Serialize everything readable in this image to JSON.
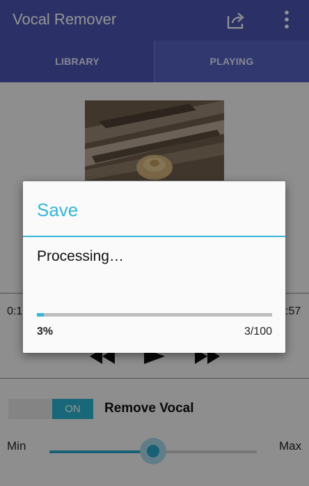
{
  "app": {
    "title": "Vocal Remover",
    "icons": {
      "share": "share-icon",
      "overflow": "more-vert-icon"
    }
  },
  "tabs": [
    {
      "label": "LIBRARY",
      "selected": false
    },
    {
      "label": "PLAYING",
      "selected": true
    }
  ],
  "player": {
    "elapsed": "0:1",
    "remaining": ":57",
    "controls": {
      "previous": "skip-previous-icon",
      "play": "play-icon",
      "next": "skip-next-icon"
    }
  },
  "remove_vocal": {
    "toggle_label": "ON",
    "label": "Remove Vocal",
    "enabled": true
  },
  "intensity": {
    "min_label": "Min",
    "max_label": "Max",
    "level": 0.5
  },
  "dialog": {
    "title": "Save",
    "message": "Processing…",
    "progress_percent": 3,
    "progress_text": "3%",
    "progress_count": "3/100"
  },
  "colors": {
    "primary": "#4a55b1",
    "accent": "#35b6d6",
    "switch_on": "#2cb3d1"
  }
}
